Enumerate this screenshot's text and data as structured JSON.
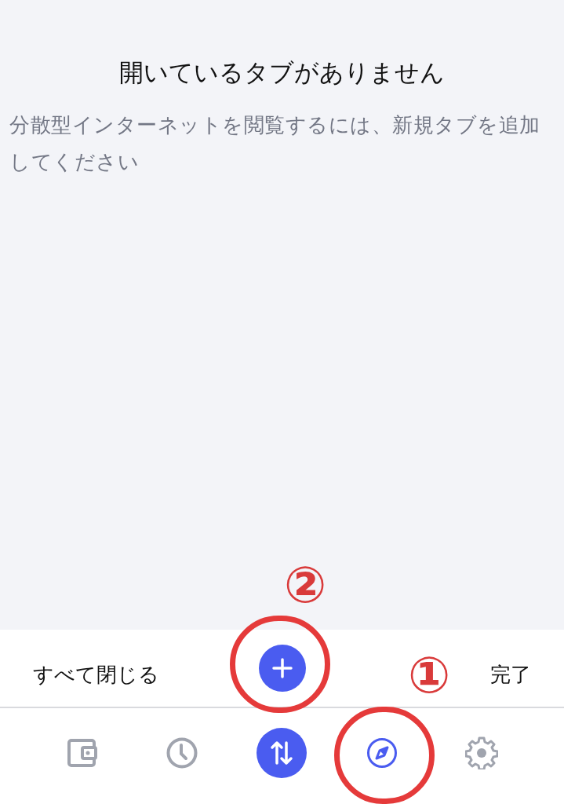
{
  "empty_state": {
    "title": "開いているタブがありません",
    "message": "分散型インターネットを閲覧するには、新規タブを追加してください"
  },
  "tab_actions": {
    "close_all": "すべて閉じる",
    "done": "完了"
  },
  "nav": [
    {
      "kind": "wallet",
      "selected": false
    },
    {
      "kind": "history",
      "selected": false
    },
    {
      "kind": "swap",
      "selected": false
    },
    {
      "kind": "browser",
      "selected": true
    },
    {
      "kind": "settings",
      "selected": false
    }
  ],
  "annotations": [
    {
      "label": "①",
      "kind": "browser"
    },
    {
      "label": "②",
      "kind": "add"
    }
  ]
}
